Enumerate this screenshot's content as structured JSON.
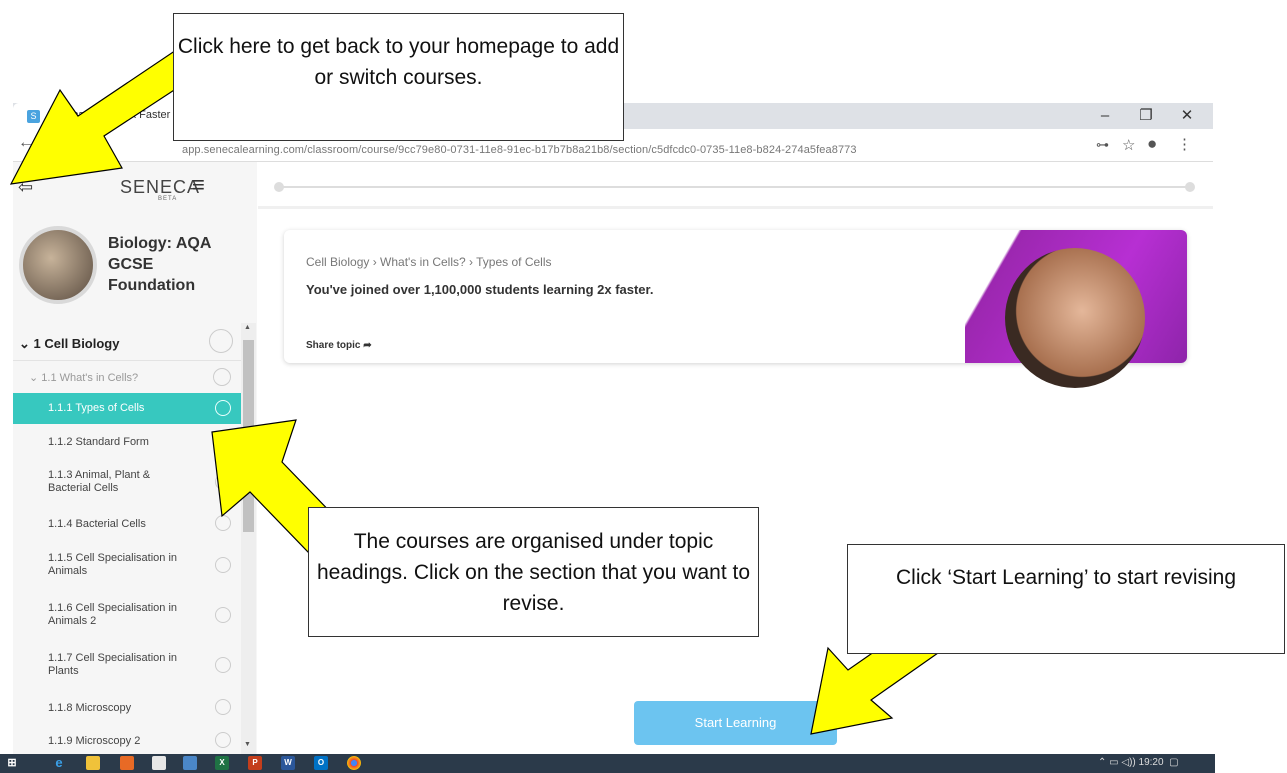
{
  "browser": {
    "tab_title": "Seneca | Learn 2x Faster",
    "favicon": "S",
    "url": "app.senecalearning.com/classroom/course/9cc79e80-0731-11e8-91ec-b17b7b8a21b8/section/c5dfcdc0-0735-11e8-b824-274a5fea8773",
    "window_buttons": [
      "–",
      "❐",
      "✕"
    ],
    "toolbar_icons": [
      "key-icon",
      "star-icon",
      "account-icon",
      "menu-dots-icon"
    ]
  },
  "sidebar": {
    "logo": "SENECA",
    "logo_tag": "BETA",
    "course_title": "Biology: AQA GCSE Foundation",
    "items": [
      {
        "label": "1 Cell Biology",
        "level": "topic"
      },
      {
        "label": "1.1 What's in Cells?",
        "level": "subtopic"
      },
      {
        "label": "1.1.1 Types of Cells",
        "level": "section",
        "active": true
      },
      {
        "label": "1.1.2 Standard Form",
        "level": "section"
      },
      {
        "label": "1.1.3 Animal, Plant & Bacterial Cells",
        "level": "section"
      },
      {
        "label": "1.1.4 Bacterial Cells",
        "level": "section"
      },
      {
        "label": "1.1.5 Cell Specialisation in Animals",
        "level": "section"
      },
      {
        "label": "1.1.6 Cell Specialisation in Animals 2",
        "level": "section"
      },
      {
        "label": "1.1.7 Cell Specialisation in Plants",
        "level": "section"
      },
      {
        "label": "1.1.8 Microscopy",
        "level": "section"
      },
      {
        "label": "1.1.9 Microscopy 2",
        "level": "section"
      }
    ]
  },
  "main": {
    "breadcrumb": "Cell Biology › What's in Cells? › Types of Cells",
    "joined_text": "You've joined over 1,100,000 students learning 2x faster.",
    "share_topic": "Share topic ➦",
    "start_button": "Start Learning",
    "accent_color": "#37c8bf"
  },
  "taskbar": {
    "time": "19:20",
    "apps": [
      "start-icon",
      "ie-icon",
      "explorer-icon",
      "media-icon",
      "word-icon",
      "calc-icon",
      "excel-icon",
      "powerpoint-icon",
      "word2-icon",
      "outlook-icon",
      "chrome-icon"
    ]
  },
  "callouts": {
    "back_home": "Click here to get back to your homepage to add or switch courses.",
    "topics": "The courses are organised under topic headings. Click on the section that you want to revise.",
    "start": "Click ‘Start Learning’ to start revising"
  }
}
